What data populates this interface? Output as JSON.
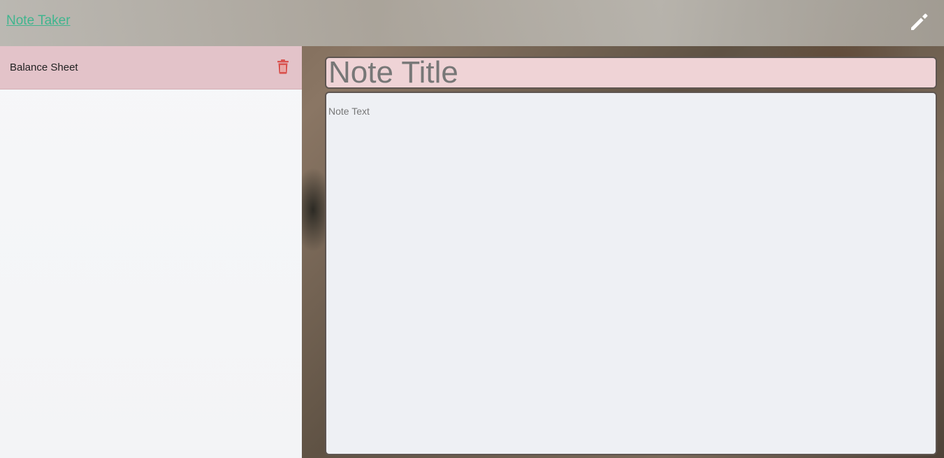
{
  "header": {
    "brand": "Note Taker",
    "new_note_icon": "pencil-icon"
  },
  "sidebar": {
    "items": [
      {
        "title": "Balance Sheet",
        "delete_icon": "trash-icon"
      }
    ]
  },
  "editor": {
    "title_placeholder": "Note Title",
    "title_value": "",
    "text_placeholder": "Note Text",
    "text_value": ""
  },
  "colors": {
    "brand": "#3fb58e",
    "active_item": "#e3c3c9",
    "delete_icon": "#d9534f",
    "title_field": "#efd3d6",
    "text_field": "#eef0f4"
  }
}
